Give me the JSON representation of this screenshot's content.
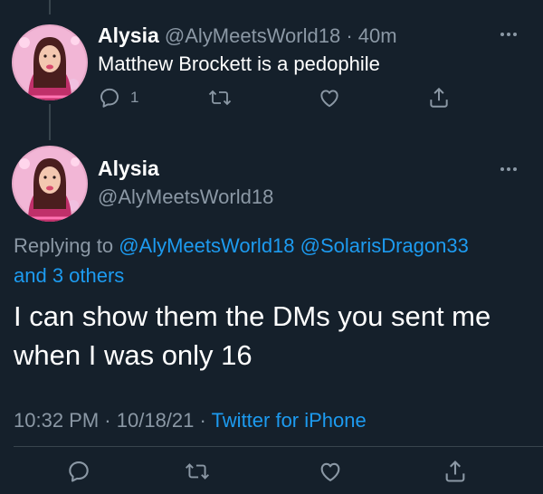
{
  "colors": {
    "background": "#15202b",
    "text_primary": "#ffffff",
    "text_muted": "#8b98a5",
    "link_blue": "#1d9bf0",
    "divider": "#38444d"
  },
  "tweet1": {
    "name": "Alysia",
    "handle": "@AlyMeetsWorld18",
    "separator": "·",
    "time": "40m",
    "text": "Matthew Brockett is a pedophile",
    "reply_count": "1",
    "icons": [
      "reply-icon",
      "retweet-icon",
      "like-icon",
      "share-icon",
      "more-icon"
    ]
  },
  "tweet2": {
    "name": "Alysia",
    "handle": "@AlyMeetsWorld18",
    "replying_prefix": "Replying to",
    "replying_mentions": "@AlyMeetsWorld18 @SolarisDragon33",
    "replying_others": "and 3 others",
    "text": "I can show them the DMs you sent me when I was only 16",
    "time": "10:32 PM",
    "separator": "·",
    "date": "10/18/21",
    "source": "Twitter for iPhone",
    "icons": [
      "reply-icon",
      "retweet-icon",
      "like-icon",
      "share-icon",
      "more-icon"
    ]
  }
}
